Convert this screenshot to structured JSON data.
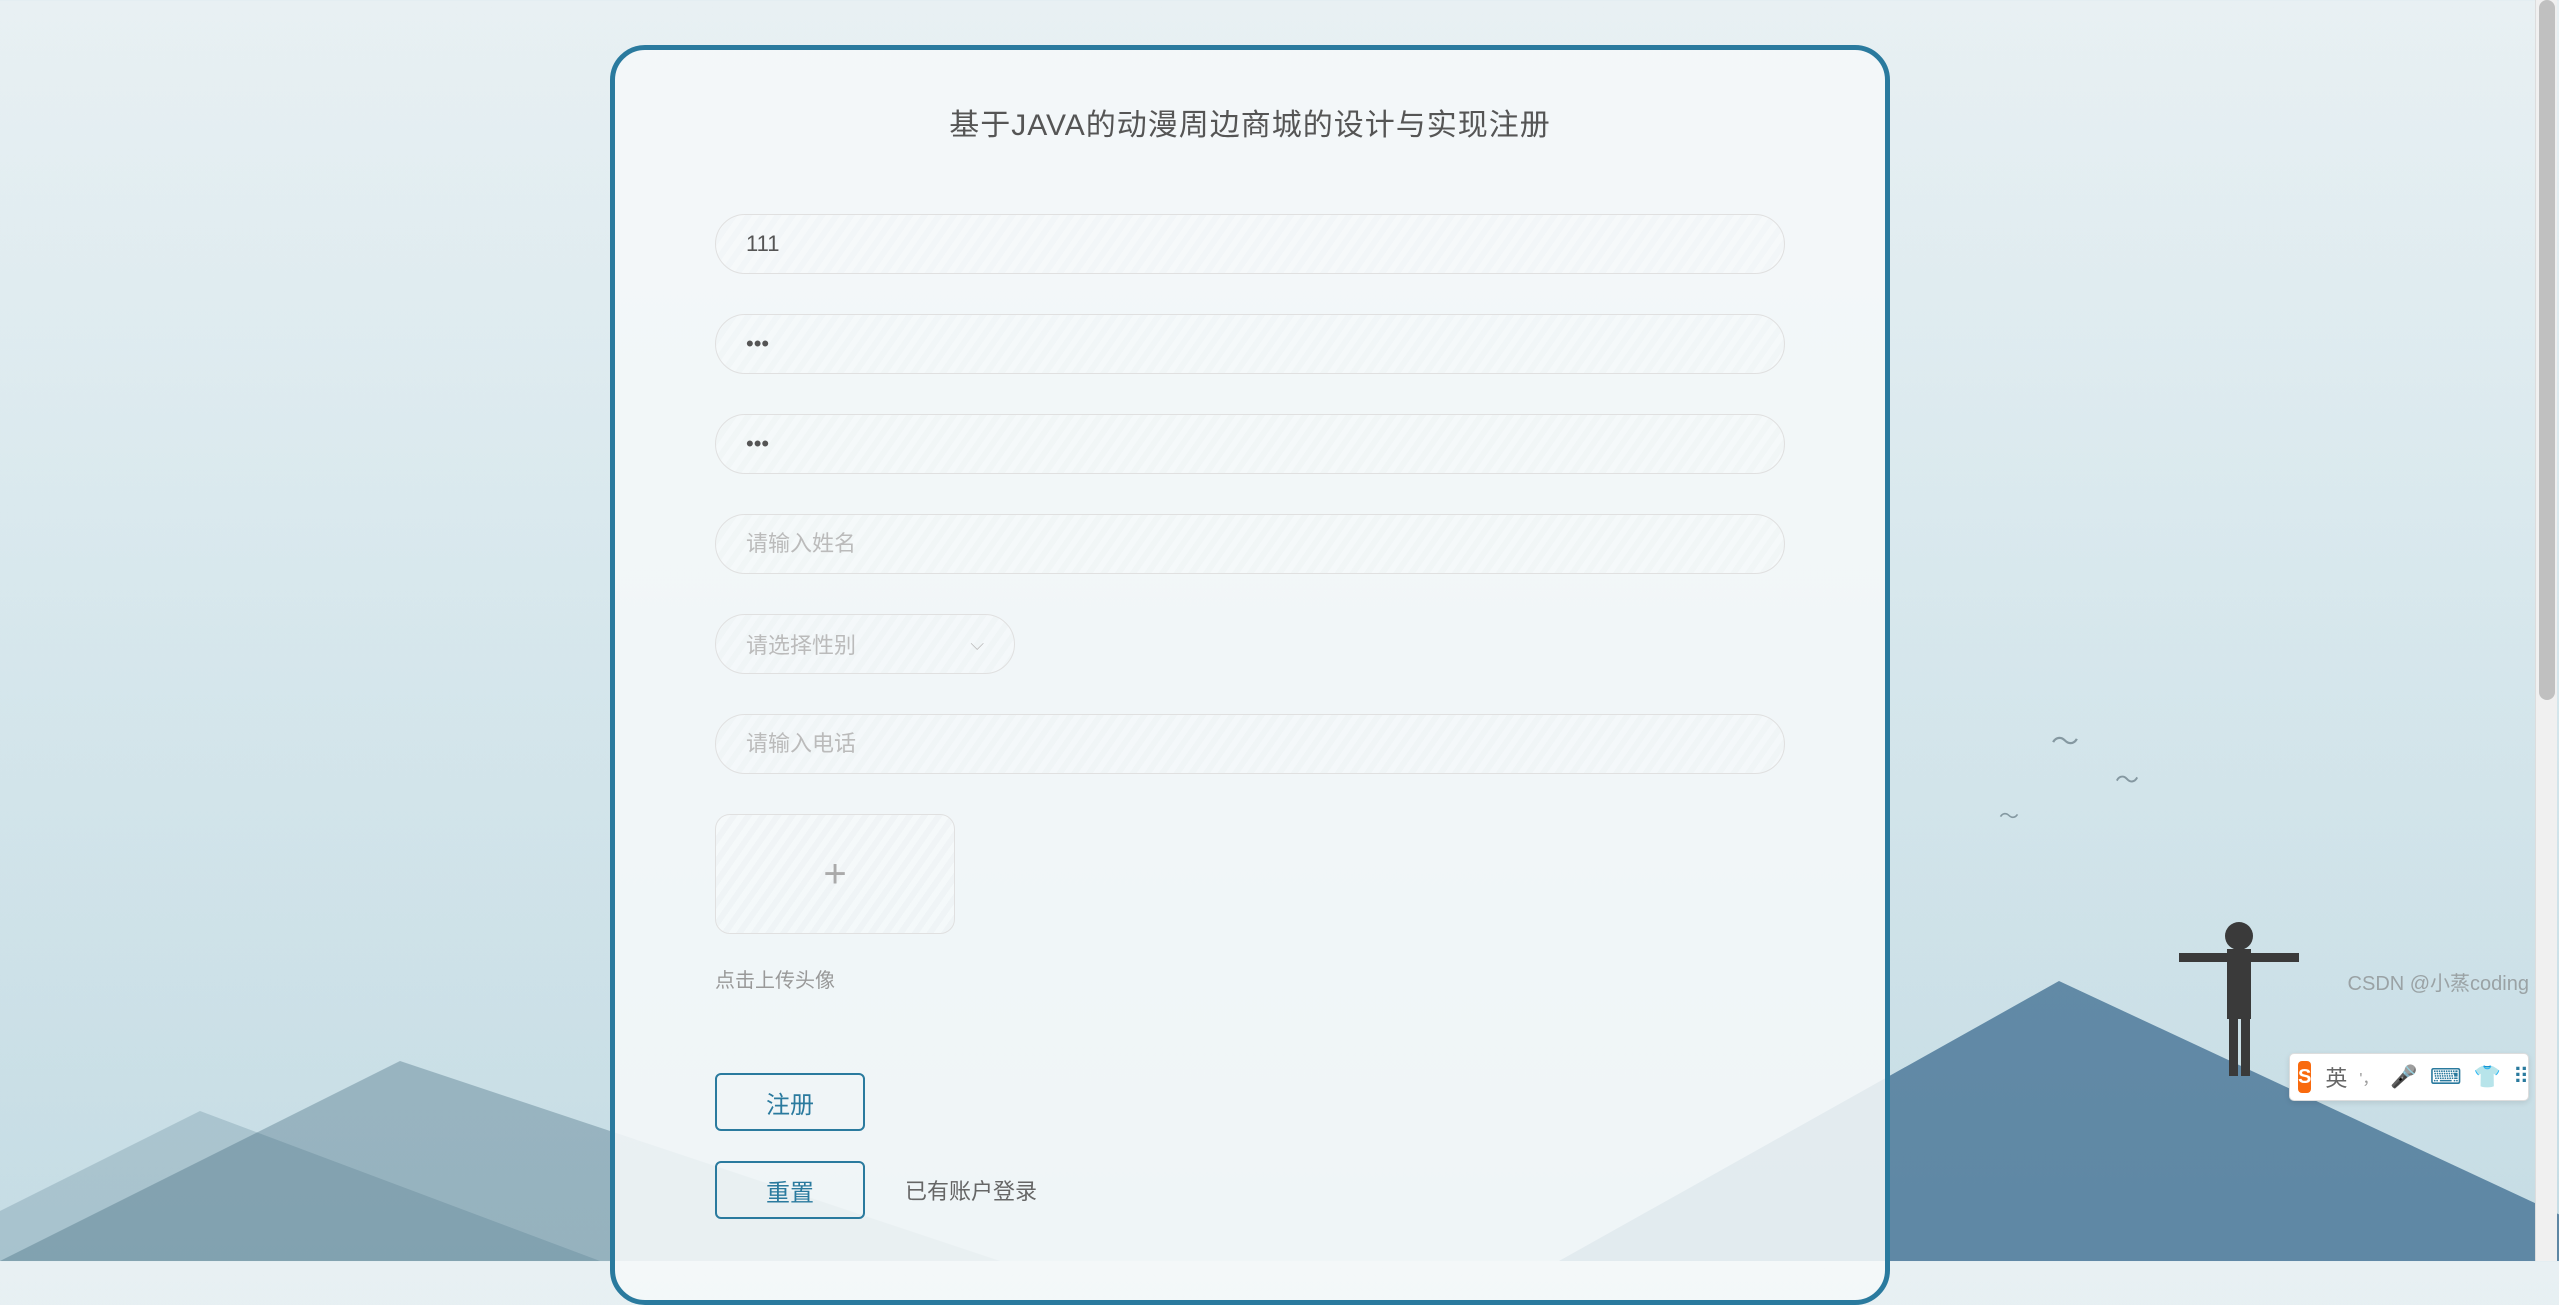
{
  "form": {
    "title": "基于JAVA的动漫周边商城的设计与实现注册",
    "username_value": "111",
    "password_value": "•••",
    "confirm_password_value": "•••",
    "name_placeholder": "请输入姓名",
    "gender_placeholder": "请选择性别",
    "phone_placeholder": "请输入电话",
    "upload_hint": "点击上传头像",
    "register_button": "注册",
    "reset_button": "重置",
    "login_link": "已有账户登录"
  },
  "ime": {
    "logo": "S",
    "lang": "英",
    "separator": "'，"
  },
  "watermark": "CSDN @小蒸coding"
}
